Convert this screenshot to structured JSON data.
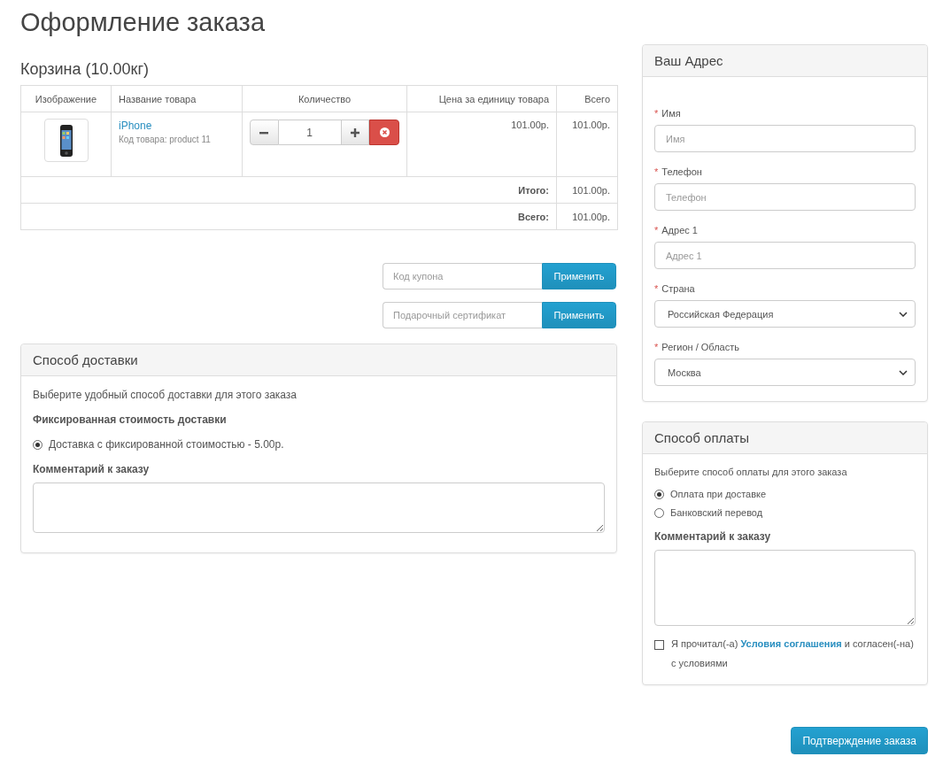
{
  "page_title": "Оформление заказа",
  "cart": {
    "title": "Корзина (10.00кг)",
    "columns": [
      "Изображение",
      "Название товара",
      "Количество",
      "Цена за единицу товара",
      "Всего"
    ],
    "rows": [
      {
        "name": "iPhone",
        "model": "Код товара: product 11",
        "quantity": "1",
        "unit_price": "101.00р.",
        "total": "101.00р."
      }
    ],
    "totals": [
      {
        "label": "Итого:",
        "value": "101.00р."
      },
      {
        "label": "Всего:",
        "value": "101.00р."
      }
    ]
  },
  "coupons": [
    {
      "placeholder": "Код купона",
      "button": "Применить"
    },
    {
      "placeholder": "Подарочный сертификат",
      "button": "Применить"
    }
  ],
  "shipping": {
    "title": "Способ доставки",
    "intro": "Выберите удобный способ доставки для этого заказа",
    "group_title": "Фиксированная стоимость доставки",
    "options": [
      {
        "label": "Доставка с фиксированной стоимостью - 5.00р.",
        "selected": true
      }
    ],
    "comment_label": "Комментарий к заказу"
  },
  "address": {
    "title": "Ваш Адрес",
    "fields": [
      {
        "kind": "text",
        "required_mark": "*",
        "label": "Имя",
        "placeholder": "Имя"
      },
      {
        "kind": "text",
        "required_mark": "*",
        "label": "Телефон",
        "placeholder": "Телефон"
      },
      {
        "kind": "text",
        "required_mark": "*",
        "label": "Адрес 1",
        "placeholder": "Адрес 1"
      },
      {
        "kind": "select",
        "required_mark": "*",
        "label": "Страна",
        "value": "Российская Федерация"
      },
      {
        "kind": "select",
        "required_mark": "*",
        "label": "Регион / Область",
        "value": "Москва"
      }
    ]
  },
  "payment": {
    "title": "Способ оплаты",
    "intro": "Выберите способ оплаты для этого заказа",
    "options": [
      {
        "label": "Оплата при доставке",
        "selected": true
      },
      {
        "label": "Банковский перевод",
        "selected": false
      }
    ],
    "comment_label": "Комментарий к заказу",
    "terms": {
      "checked": false,
      "before": "Я прочитал(-а) ",
      "link": "Условия соглашения",
      "after": " и согласен(-на) с условиями"
    }
  },
  "confirm_button": "Подтверждение заказа"
}
